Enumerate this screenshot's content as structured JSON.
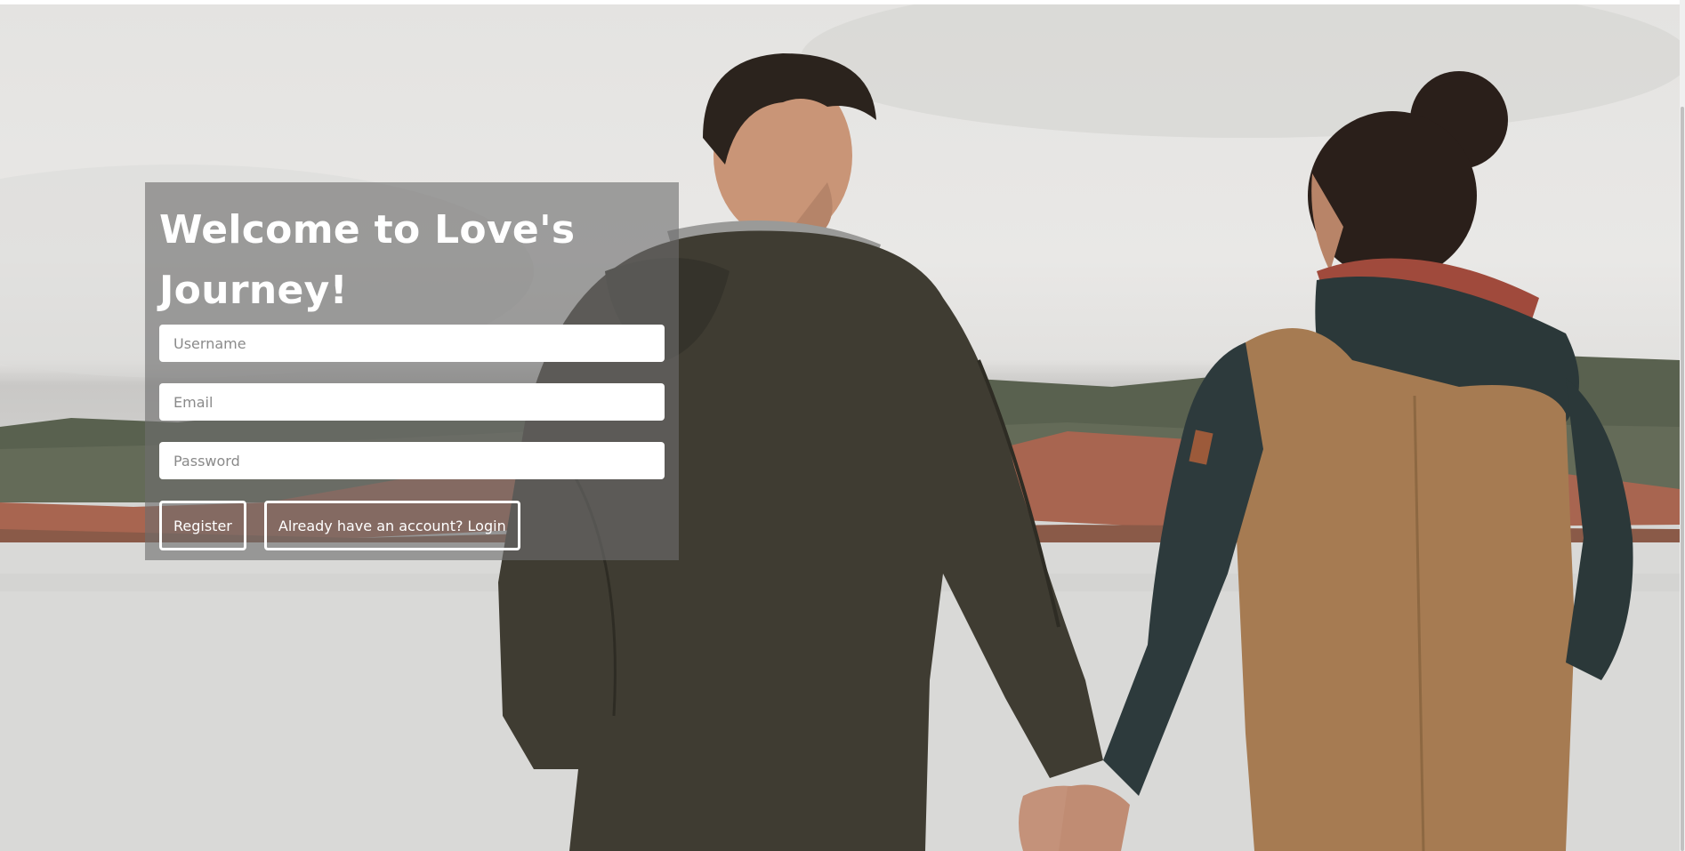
{
  "hero": {
    "image_alt": "Couple holding hands by a lake",
    "accent_colors": {
      "sky": "#e6e5e3",
      "hills": "#4f5847",
      "rock": "#a8614c",
      "water": "#d8d8d6",
      "jacket_dark": "#3f3d33",
      "jacket_tan": "#a67c52",
      "jacket_teal": "#2c3a3c"
    }
  },
  "form": {
    "title": "Welcome to Love's Journey!",
    "username_placeholder": "Username",
    "email_placeholder": "Email",
    "password_placeholder": "Password",
    "register_label": "Register",
    "login_label": "Already have an account? Login"
  }
}
